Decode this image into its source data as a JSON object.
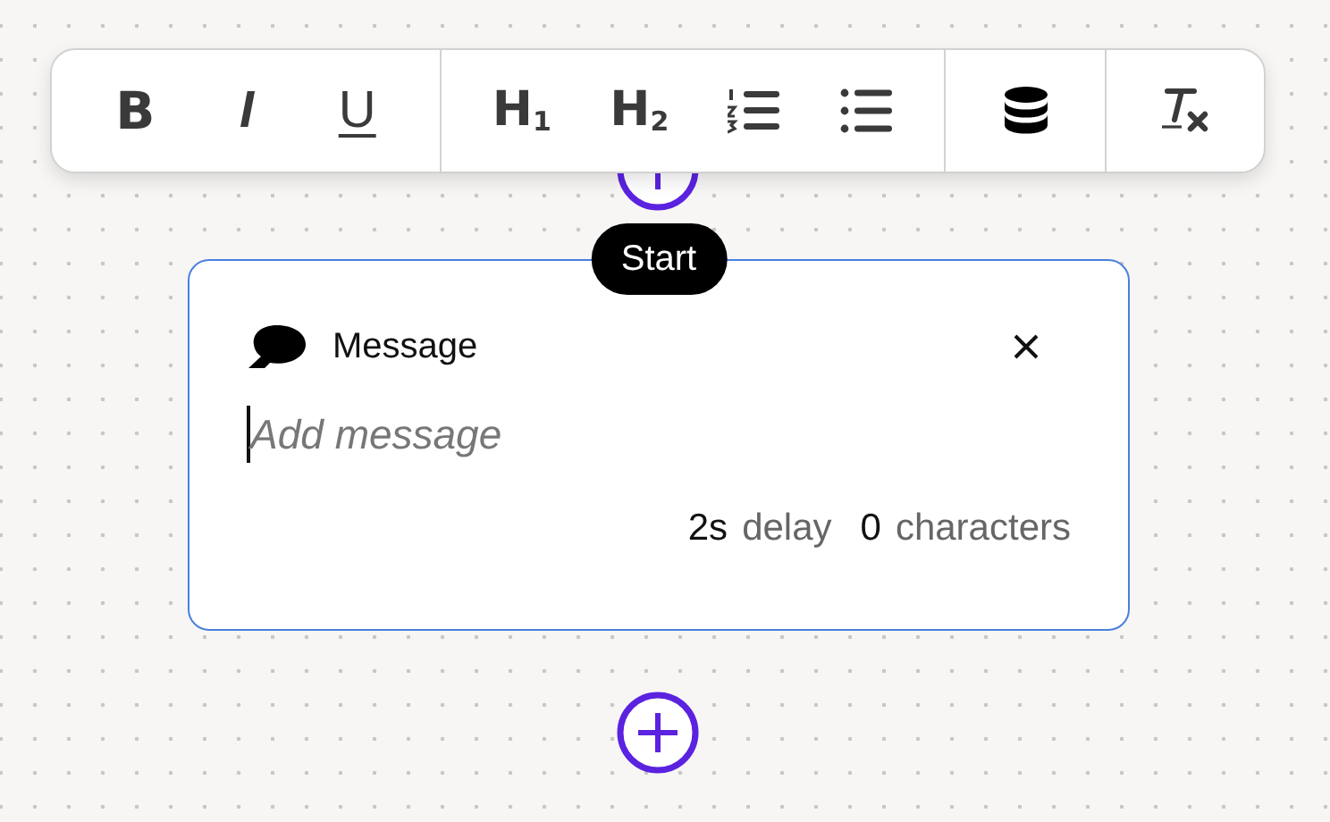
{
  "toolbar": {
    "groups": [
      {
        "items": [
          {
            "kind": "bold",
            "label": "B"
          },
          {
            "kind": "italic",
            "label": "I"
          },
          {
            "kind": "underline",
            "label": "U"
          }
        ]
      },
      {
        "items": [
          {
            "kind": "heading",
            "label": "H$_{1}$"
          },
          {
            "kind": "heading",
            "label": "H$_{2}$"
          },
          {
            "kind": "ordered-list"
          },
          {
            "kind": "bullet-list"
          }
        ]
      },
      {
        "items": [
          {
            "kind": "database"
          }
        ]
      },
      {
        "items": [
          {
            "kind": "clear-format"
          }
        ]
      }
    ]
  },
  "card": {
    "badge": "Start",
    "title": "Message",
    "focused": true,
    "placeholder": "Add message",
    "delay_value": "2s",
    "delay_label": "delay",
    "count_value": "0",
    "count_label": "characters"
  }
}
